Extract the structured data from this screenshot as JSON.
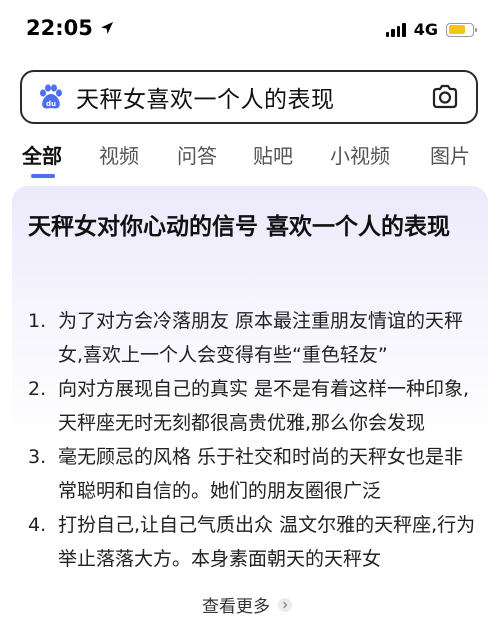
{
  "status_bar": {
    "time": "22:05",
    "network": "4G",
    "battery_level": 0.75,
    "colors": {
      "battery": "#f5c518"
    }
  },
  "search": {
    "query": "天秤女喜欢一个人的表现",
    "icons": {
      "logo": "baidu-paw-icon",
      "camera": "camera-icon"
    },
    "colors": {
      "logo": "#4e6ef2"
    }
  },
  "tabs": [
    {
      "label": "全部",
      "active": true
    },
    {
      "label": "视频",
      "active": false
    },
    {
      "label": "问答",
      "active": false
    },
    {
      "label": "贴吧",
      "active": false
    },
    {
      "label": "小视频",
      "active": false
    },
    {
      "label": "图片",
      "active": false
    }
  ],
  "result_card": {
    "title": "天秤女对你心动的信号 喜欢一个人的表现",
    "items": [
      {
        "num": "1.",
        "text": "为了对方会冷落朋友 原本最注重朋友情谊的天秤女,喜欢上一个人会变得有些“重色轻友”"
      },
      {
        "num": "2.",
        "text": "向对方展现自己的真实 是不是有着这样一种印象,天秤座无时无刻都很高贵优雅,那么你会发现"
      },
      {
        "num": "3.",
        "text": "毫无顾忌的风格 乐于社交和时尚的天秤女也是非常聪明和自信的。她们的朋友圈很广泛"
      },
      {
        "num": "4.",
        "text": "打扮自己,让自己气质出众 温文尔雅的天秤座,行为举止落落大方。本身素面朝天的天秤女"
      }
    ],
    "more_label": "查看更多",
    "colors": {
      "gradient_top": "#ece9fb",
      "accent": "#4e6ef2"
    }
  }
}
